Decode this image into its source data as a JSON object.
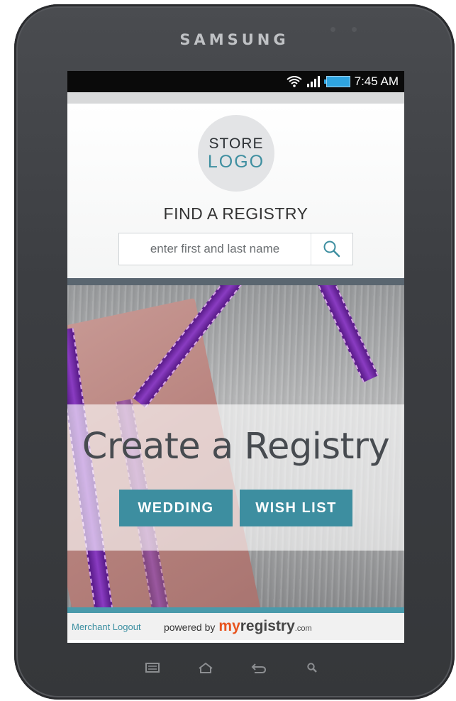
{
  "device": {
    "brand": "SAMSUNG"
  },
  "statusbar": {
    "time": "7:45 AM",
    "icons": [
      "wifi-icon",
      "signal-icon",
      "battery-icon"
    ]
  },
  "header": {
    "logo_line1": "STORE",
    "logo_line2": "LOGO",
    "find_title": "FIND A REGISTRY",
    "search_placeholder": "enter first and last name"
  },
  "hero": {
    "title": "Create a Registry",
    "buttons": [
      {
        "label": "WEDDING"
      },
      {
        "label": "WISH LIST"
      }
    ]
  },
  "footer": {
    "merchant_logout": "Merchant Logout",
    "powered_by": "powered by",
    "brand_my": "my",
    "brand_registry": "registry",
    "brand_com": ".com"
  },
  "navkeys": [
    "menu-icon",
    "home-icon",
    "back-icon",
    "search-icon"
  ],
  "colors": {
    "accent": "#3d8ea0",
    "brand_orange": "#e8541e",
    "divider": "#5a6670"
  }
}
